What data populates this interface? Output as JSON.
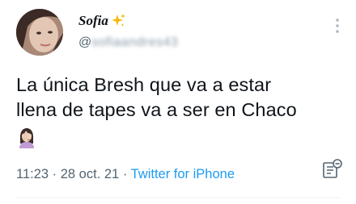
{
  "tweet": {
    "display_name": "Sofia",
    "name_emoji": "sparkles-icon",
    "handle_prefix": "@",
    "handle_obscured": "sofiaandres43",
    "text_line1": "La única Bresh que va a estar",
    "text_line2": "llena de tapes va a ser en Chaco",
    "trailing_emoji": "woman-facepalming-icon",
    "time": "11:23",
    "separator1": " · ",
    "date": "28 oct. 21",
    "separator2": " · ",
    "source": "Twitter for iPhone"
  },
  "colors": {
    "text": "#0f1419",
    "secondary": "#536471",
    "link": "#1d9bf0",
    "sparkle": "#f5b800",
    "divider": "#eff3f4"
  }
}
